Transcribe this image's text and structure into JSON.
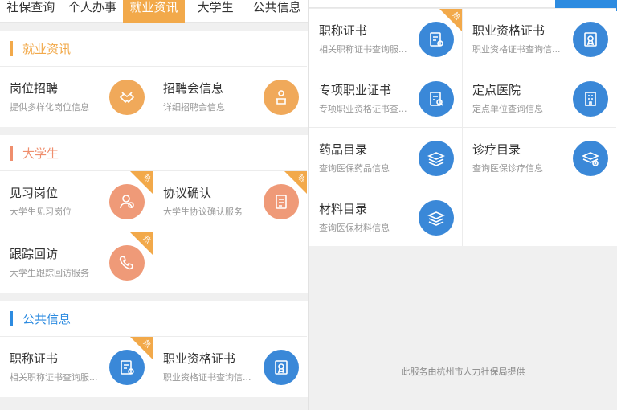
{
  "left": {
    "tabs": [
      "社保查询",
      "个人办事",
      "就业资讯",
      "大学生",
      "公共信息"
    ],
    "active_tab": 2,
    "sections": [
      {
        "title": "就业资讯",
        "color": "#f2a94a",
        "items": [
          {
            "name": "岗位招聘",
            "desc": "提供多样化岗位信息",
            "icon": "handshake-icon",
            "color": "orange",
            "hot": false
          },
          {
            "name": "招聘会信息",
            "desc": "详细招聘会信息",
            "icon": "person-desk-icon",
            "color": "orange",
            "hot": false
          }
        ]
      },
      {
        "title": "大学生",
        "color": "#ef8e6d",
        "items": [
          {
            "name": "见习岗位",
            "desc": "大学生见习岗位",
            "icon": "person-icon",
            "color": "salmon",
            "hot": true
          },
          {
            "name": "协议确认",
            "desc": "大学生协议确认服务",
            "icon": "document-check-icon",
            "color": "salmon",
            "hot": true
          },
          {
            "name": "跟踪回访",
            "desc": "大学生跟踪回访服务",
            "icon": "phone-icon",
            "color": "salmon",
            "hot": true
          }
        ]
      },
      {
        "title": "公共信息",
        "color": "#2d8be0",
        "items": [
          {
            "name": "职称证书",
            "desc": "相关职称证书查询服...",
            "icon": "certificate-icon",
            "color": "blue",
            "hot": true
          },
          {
            "name": "职业资格证书",
            "desc": "职业资格证书查询信...",
            "icon": "badge-icon",
            "color": "blue",
            "hot": false
          }
        ]
      }
    ],
    "hot_label": "热"
  },
  "right": {
    "tabs": [
      "社保查询",
      "个人办事",
      "就业资讯",
      "大学生",
      "公共信息"
    ],
    "active_tab": 4,
    "items": [
      {
        "name": "职称证书",
        "desc": "相关职称证书查询服...",
        "icon": "certificate-icon",
        "hot": true
      },
      {
        "name": "职业资格证书",
        "desc": "职业资格证书查询信...",
        "icon": "badge-icon",
        "hot": false
      },
      {
        "name": "专项职业证书",
        "desc": "专项职业资格证书查...",
        "icon": "special-cert-icon",
        "hot": false
      },
      {
        "name": "定点医院",
        "desc": "定点单位查询信息",
        "icon": "hospital-icon",
        "hot": false
      },
      {
        "name": "药品目录",
        "desc": "查询医保药品信息",
        "icon": "stack-icon",
        "hot": false
      },
      {
        "name": "诊疗目录",
        "desc": "查询医保诊疗信息",
        "icon": "stack-plus-icon",
        "hot": false
      },
      {
        "name": "材料目录",
        "desc": "查询医保材料信息",
        "icon": "stack-icon",
        "hot": false
      }
    ],
    "footer": "此服务由杭州市人力社保局提供"
  }
}
